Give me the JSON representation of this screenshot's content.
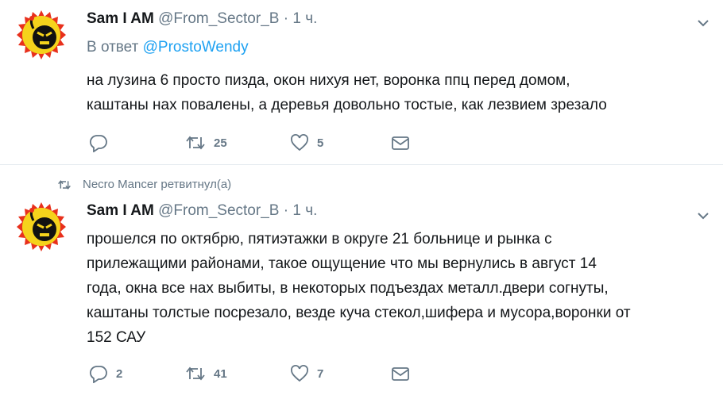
{
  "tweets": [
    {
      "author_name": "Sam I AM",
      "author_handle": "@From_Sector_B",
      "separator": "·",
      "time": "1 ч.",
      "reply_to_prefix": "В ответ",
      "reply_to_mention": "@ProstoWendy",
      "text_lines": [
        "на лузина 6 просто пизда, окон нихуя нет, воронка ппц перед домом,",
        "каштаны нах повалены, а деревья довольно тостые, как лезвием зрезало"
      ],
      "reply_count": "",
      "retweet_count": "25",
      "like_count": "5"
    },
    {
      "retweeted_by": "Necro Mancer ретвитнул(а)",
      "author_name": "Sam I AM",
      "author_handle": "@From_Sector_B",
      "separator": "·",
      "time": "1 ч.",
      "text_lines": [
        "прошелся по октябрю, пятиэтажки в округе 21 больнице и рынка с",
        "прилежащими районами, такое ощущение что мы вернулись в август 14",
        "года, окна все нах выбиты, в некоторых подъездах металл.двери согнуты,",
        "каштаны толстые посрезало, везде куча стекол,шифера и мусора,воронки от",
        "152 САУ"
      ],
      "reply_count": "2",
      "retweet_count": "41",
      "like_count": "7"
    }
  ],
  "icons": {
    "avatar": "angry-bomb-face-icon",
    "caret": "chevron-down-icon",
    "reply": "reply-bubble-icon",
    "retweet": "retweet-icon",
    "like": "heart-icon",
    "dm": "envelope-icon"
  },
  "colors": {
    "icon_gray": "#657786",
    "link_blue": "#1da1f2",
    "divider": "#e6ecf0",
    "avatar_yellow": "#f5d31c",
    "avatar_red": "#e8301c"
  }
}
